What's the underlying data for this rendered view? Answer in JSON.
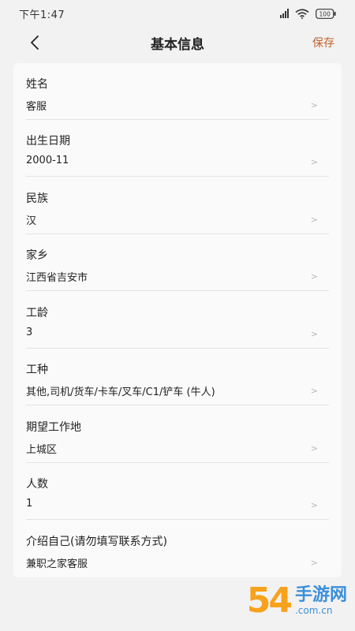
{
  "status_bar": {
    "time": "下午1:47",
    "battery": "100"
  },
  "header": {
    "title": "基本信息",
    "save_label": "保存"
  },
  "fields": [
    {
      "label": "姓名",
      "value": "客服"
    },
    {
      "label": "出生日期",
      "value": "2000-11"
    },
    {
      "label": "民族",
      "value": "汉"
    },
    {
      "label": "家乡",
      "value": "江西省吉安市"
    },
    {
      "label": "工龄",
      "value": "3"
    },
    {
      "label": "工种",
      "value": "其他,司机/货车/卡车/叉车/C1/铲车 (牛人)"
    },
    {
      "label": "期望工作地",
      "value": "上城区"
    },
    {
      "label": "人数",
      "value": "1"
    },
    {
      "label": "介绍自己(请勿填写联系方式)",
      "value": "兼职之家客服"
    }
  ],
  "watermark": {
    "number": "54",
    "brand": "手游网",
    "url": ".com.cn"
  }
}
